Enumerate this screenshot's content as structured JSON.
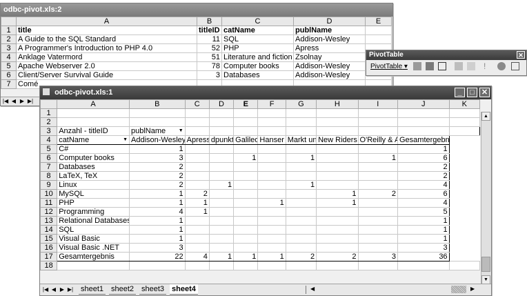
{
  "back_window": {
    "title": "odbc-pivot.xls:2",
    "columns": [
      "",
      "A",
      "B",
      "C",
      "D",
      "E"
    ],
    "rows": [
      {
        "n": "1",
        "a": "title",
        "b": "titleID",
        "c": "catName",
        "d": "publName",
        "bold": true
      },
      {
        "n": "2",
        "a": "A Guide to the SQL Standard",
        "b": "11",
        "c": "SQL",
        "d": "Addison-Wesley"
      },
      {
        "n": "3",
        "a": "A Programmer's Introduction to PHP 4.0",
        "b": "52",
        "c": "PHP",
        "d": "Apress"
      },
      {
        "n": "4",
        "a": "Anklage Vatermord",
        "b": "51",
        "c": "Literature and fiction",
        "d": "Zsolnay"
      },
      {
        "n": "5",
        "a": "Apache Webserver 2.0",
        "b": "78",
        "c": "Computer books",
        "d": "Addison-Wesley"
      },
      {
        "n": "6",
        "a": "Client/Server Survival Guide",
        "b": "3",
        "c": "Databases",
        "d": "Addison-Wesley"
      },
      {
        "n": "7",
        "a": "Comé",
        "b": "",
        "c": "",
        "d": ""
      }
    ]
  },
  "pivot_toolbar": {
    "title": "PivotTable",
    "menu_label": "PivotTable",
    "close": "✕"
  },
  "front_window": {
    "title": "odbc-pivot.xls:1",
    "columns": [
      "",
      "A",
      "B",
      "C",
      "D",
      "E",
      "F",
      "G",
      "H",
      "I",
      "J",
      "K"
    ],
    "pivot_field_label": "Anzahl - titleID",
    "pivot_col_field": "publName",
    "pivot_row_field": "catName",
    "publishers": [
      "Addison-Wesley",
      "Apress",
      "dpunkt",
      "Galileo",
      "Hanser",
      "Markt und",
      "New Riders",
      "O'Reilly & A",
      "Gesamtergebnis"
    ],
    "data_rows": [
      {
        "n": "5",
        "cat": "C#",
        "v": [
          "1",
          "",
          "",
          "",
          "",
          "",
          "",
          "",
          "1"
        ]
      },
      {
        "n": "6",
        "cat": "Computer books",
        "v": [
          "3",
          "",
          "",
          "1",
          "",
          "1",
          "",
          "1",
          "6"
        ]
      },
      {
        "n": "7",
        "cat": "Databases",
        "v": [
          "2",
          "",
          "",
          "",
          "",
          "",
          "",
          "",
          "2"
        ]
      },
      {
        "n": "8",
        "cat": "LaTeX, TeX",
        "v": [
          "2",
          "",
          "",
          "",
          "",
          "",
          "",
          "",
          "2"
        ]
      },
      {
        "n": "9",
        "cat": "Linux",
        "v": [
          "2",
          "",
          "1",
          "",
          "",
          "1",
          "",
          "",
          "4"
        ]
      },
      {
        "n": "10",
        "cat": "MySQL",
        "v": [
          "1",
          "2",
          "",
          "",
          "",
          "",
          "1",
          "2",
          "6"
        ]
      },
      {
        "n": "11",
        "cat": "PHP",
        "v": [
          "1",
          "1",
          "",
          "",
          "1",
          "",
          "1",
          "",
          "4"
        ]
      },
      {
        "n": "12",
        "cat": "Programming",
        "v": [
          "4",
          "1",
          "",
          "",
          "",
          "",
          "",
          "",
          "5"
        ]
      },
      {
        "n": "13",
        "cat": "Relational Databases",
        "v": [
          "1",
          "",
          "",
          "",
          "",
          "",
          "",
          "",
          "1"
        ]
      },
      {
        "n": "14",
        "cat": "SQL",
        "v": [
          "1",
          "",
          "",
          "",
          "",
          "",
          "",
          "",
          "1"
        ]
      },
      {
        "n": "15",
        "cat": "Visual Basic",
        "v": [
          "1",
          "",
          "",
          "",
          "",
          "",
          "",
          "",
          "1"
        ]
      },
      {
        "n": "16",
        "cat": "Visual Basic .NET",
        "v": [
          "3",
          "",
          "",
          "",
          "",
          "",
          "",
          "",
          "3"
        ]
      }
    ],
    "total_row": {
      "n": "17",
      "cat": "Gesamtergebnis",
      "v": [
        "22",
        "4",
        "1",
        "1",
        "1",
        "2",
        "2",
        "3",
        "36"
      ]
    },
    "empty_rows": [
      "1",
      "2",
      "18"
    ],
    "header_rows": {
      "r3": "3",
      "r4": "4"
    },
    "sheet_tabs": [
      "sheet1",
      "sheet2",
      "sheet3",
      "sheet4"
    ],
    "active_tab": "sheet4"
  }
}
